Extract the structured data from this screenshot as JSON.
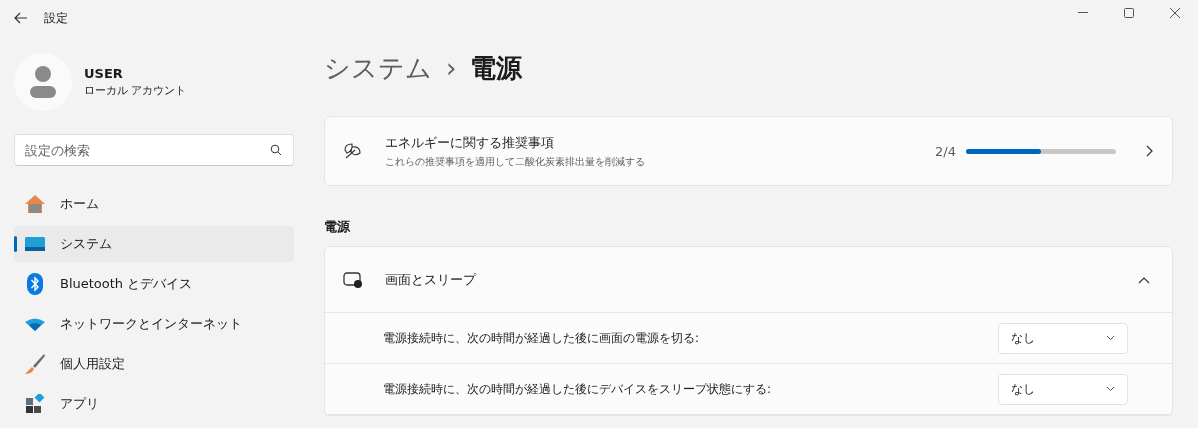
{
  "window": {
    "title": "設定"
  },
  "user": {
    "name": "USER",
    "account": "ローカル アカウント"
  },
  "search": {
    "placeholder": "設定の検索"
  },
  "nav": [
    {
      "kind": "home",
      "label": "ホーム",
      "selected": false
    },
    {
      "kind": "system",
      "label": "システム",
      "selected": true
    },
    {
      "kind": "bluetooth",
      "label": "Bluetooth とデバイス",
      "selected": false
    },
    {
      "kind": "network",
      "label": "ネットワークとインターネット",
      "selected": false
    },
    {
      "kind": "personalize",
      "label": "個人用設定",
      "selected": false
    },
    {
      "kind": "apps",
      "label": "アプリ",
      "selected": false
    }
  ],
  "breadcrumb": {
    "parent": "システム",
    "separator": "›",
    "current": "電源"
  },
  "recommendation": {
    "title": "エネルギーに関する推奨事項",
    "subtitle": "これらの推奨事項を適用して二酸化炭素排出量を削減する",
    "count": "2/4",
    "level": 0.5
  },
  "section_title": "電源",
  "screen_sleep": {
    "title": "画面とスリープ",
    "expanded": true,
    "rows": [
      {
        "label": "電源接続時に、次の時間が経過した後に画面の電源を切る:",
        "value": "なし"
      },
      {
        "label": "電源接続時に、次の時間が経過した後にデバイスをスリープ状態にする:",
        "value": "なし"
      }
    ]
  }
}
